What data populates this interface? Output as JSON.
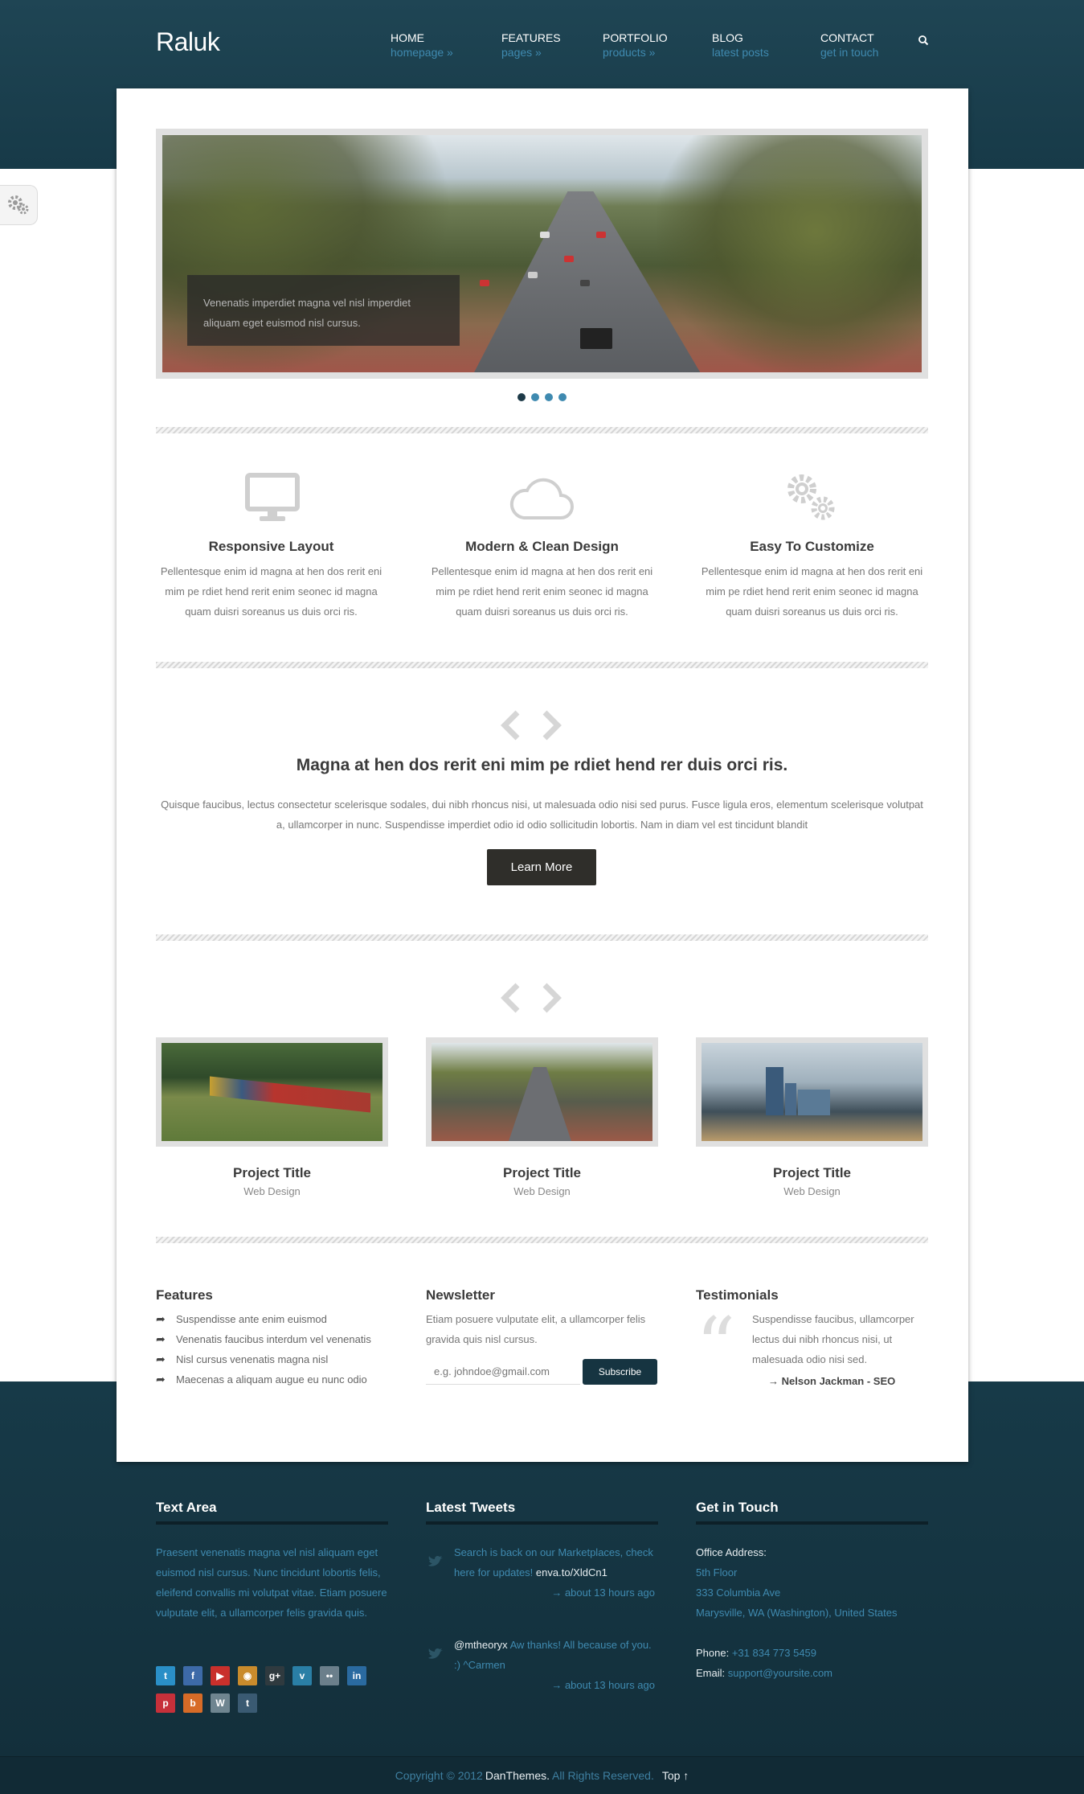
{
  "brand": {
    "logo": "Raluk"
  },
  "nav": [
    {
      "title": "HOME",
      "sub": "homepage »"
    },
    {
      "title": "FEATURES",
      "sub": "pages »"
    },
    {
      "title": "PORTFOLIO",
      "sub": "products »"
    },
    {
      "title": "BLOG",
      "sub": "latest posts"
    },
    {
      "title": "CONTACT",
      "sub": "get in touch"
    }
  ],
  "slider": {
    "caption": "Venenatis imperdiet magna vel nisl imperdiet aliquam eget euismod nisl cursus.",
    "slide_count": 4,
    "active_index": 0
  },
  "features": [
    {
      "icon": "monitor-icon",
      "title": "Responsive Layout",
      "text": "Pellentesque enim id magna at hen dos rerit eni mim pe rdiet hend rerit enim seonec id magna quam duisri soreanus us duis orci ris."
    },
    {
      "icon": "cloud-icon",
      "title": "Modern & Clean Design",
      "text": "Pellentesque enim id magna at hen dos rerit eni mim pe rdiet hend rerit enim seonec id magna quam duisri soreanus us duis orci ris."
    },
    {
      "icon": "gears-icon",
      "title": "Easy To Customize",
      "text": "Pellentesque enim id magna at hen dos rerit eni mim pe rdiet hend rerit enim seonec id magna quam duisri soreanus us duis orci ris."
    }
  ],
  "callout": {
    "heading": "Magna at hen dos rerit eni mim pe rdiet hend rer duis orci ris.",
    "text": "Quisque faucibus, lectus consectetur scelerisque sodales, dui nibh rhoncus nisi, ut malesuada odio nisi sed purus. Fusce ligula eros, elementum scelerisque volutpat a, ullamcorper in nunc. Suspendisse imperdiet odio id odio sollicitudin lobortis. Nam in diam vel est tincidunt blandit",
    "button": "Learn More"
  },
  "projects": [
    {
      "title": "Project Title",
      "category": "Web Design"
    },
    {
      "title": "Project Title",
      "category": "Web Design"
    },
    {
      "title": "Project Title",
      "category": "Web Design"
    }
  ],
  "widgets": {
    "features": {
      "title": "Features",
      "items": [
        "Suspendisse ante enim euismod",
        "Venenatis faucibus interdum vel venenatis",
        "Nisl cursus venenatis magna nisl",
        "Maecenas a aliquam augue eu nunc odio"
      ]
    },
    "newsletter": {
      "title": "Newsletter",
      "text": "Etiam posuere vulputate elit, a ullamcorper felis gravida quis nisl cursus.",
      "placeholder": "e.g. johndoe@gmail.com",
      "button": "Subscribe"
    },
    "testimonials": {
      "title": "Testimonials",
      "quote": "Suspendisse faucibus, ullamcorper lectus dui nibh rhoncus nisi, ut malesuada odio nisi sed.",
      "author": "→ Nelson Jackman - SEO"
    }
  },
  "footer": {
    "text_area": {
      "title": "Text Area",
      "text": "Praesent venenatis magna vel nisl aliquam eget euismod nisl cursus. Nunc tincidunt lobortis felis, eleifend convallis mi volutpat vitae. Etiam posuere vulputate elit, a ullamcorper felis gravida quis."
    },
    "tweets": {
      "title": "Latest Tweets",
      "items": [
        {
          "text": "Search is back on our Marketplaces, check here for updates!",
          "link": "enva.to/XldCn1",
          "time": "→ about 13 hours ago"
        },
        {
          "handle": "@mtheoryx",
          "text": "Aw thanks! All because of you. :) ^Carmen",
          "time": "→ about 13 hours ago"
        }
      ]
    },
    "contact": {
      "title": "Get in Touch",
      "office_label": "Office Address:",
      "address": [
        "5th Floor",
        "333 Columbia Ave",
        "Marysville, WA (Washington), United States"
      ],
      "phone_label": "Phone:",
      "phone": "+31 834 773 5459",
      "email_label": "Email:",
      "email": "support@yoursite.com"
    },
    "social": [
      {
        "icon": "twitter-icon",
        "glyph": "t",
        "color": "#2a8fc7"
      },
      {
        "icon": "facebook-icon",
        "glyph": "f",
        "color": "#3d6aa8"
      },
      {
        "icon": "youtube-icon",
        "glyph": "▶",
        "color": "#c9302c"
      },
      {
        "icon": "rss-icon",
        "glyph": "◉",
        "color": "#c98b2c"
      },
      {
        "icon": "googleplus-icon",
        "glyph": "g+",
        "color": "#2f3a3f"
      },
      {
        "icon": "vimeo-icon",
        "glyph": "v",
        "color": "#2a7fa6"
      },
      {
        "icon": "flickr-icon",
        "glyph": "••",
        "color": "#6b7f8b"
      },
      {
        "icon": "linkedin-icon",
        "glyph": "in",
        "color": "#2a6aa0"
      },
      {
        "icon": "pinterest-icon",
        "glyph": "p",
        "color": "#c6303a"
      },
      {
        "icon": "blogger-icon",
        "glyph": "b",
        "color": "#d76b27"
      },
      {
        "icon": "wordpress-icon",
        "glyph": "W",
        "color": "#6f8590"
      },
      {
        "icon": "tumblr-icon",
        "glyph": "t",
        "color": "#3a5a72"
      }
    ]
  },
  "copyright": {
    "prefix": "Copyright © 2012",
    "company": "DanThemes.",
    "suffix": "All Rights Reserved.",
    "top_link": "Top ↑"
  }
}
